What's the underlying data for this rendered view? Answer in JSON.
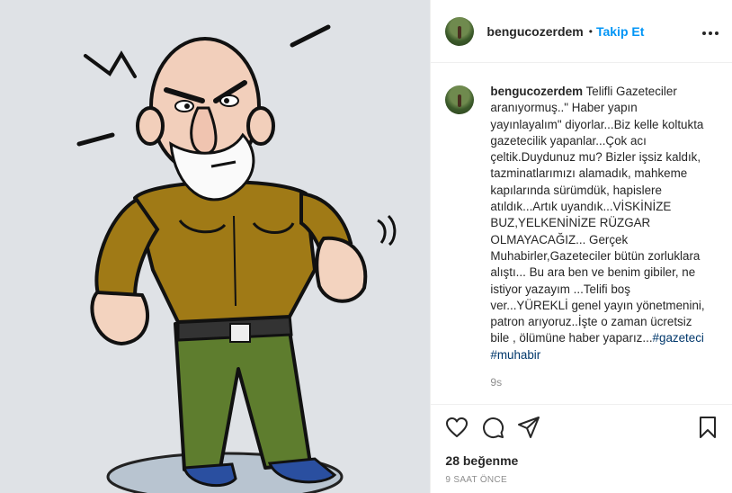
{
  "post": {
    "username": "bengucozerdem",
    "follow_label": "Takip Et",
    "separator": "•",
    "more_label": "•••",
    "caption_text": "Telifli Gazeteciler aranıyormuş..\" Haber yapın yayınlayalım\" diyorlar...Biz kelle koltukta gazetecilik yapanlar...Çok acı çeltik.Duydunuz mu? Bizler işsiz kaldık, tazminatlarımızı alamadık, mahkeme kapılarında sürümdük, hapislere atıldık...Artık uyandık...VİSKİNİZE BUZ,YELKENİNİZE RÜZGAR OLMAYACAĞIZ... Gerçek Muhabirler,Gazeteciler bütün zorluklara alıştı... Bu ara ben ve benim gibiler, ne istiyor yazayım ...Telifi boş ver...YÜREKLİ genel yayın yönetmenini, patron arıyoruz..İşte o zaman ücretsiz bile , ölümüne haber yaparız...",
    "hashtag_1": "#gazeteci",
    "hashtag_2": "#muhabir",
    "comment_age": "9s",
    "likes_label": "28 beğenme",
    "posted_ago": "9 SAAT ÖNCE"
  },
  "icons": {
    "like": "heart-icon",
    "comment": "comment-icon",
    "share": "share-icon",
    "save": "bookmark-icon",
    "more": "more-options-icon"
  },
  "colors": {
    "follow": "#0095f6",
    "hashtag": "#00376b",
    "muted": "#8e8e8e",
    "text": "#262626"
  }
}
